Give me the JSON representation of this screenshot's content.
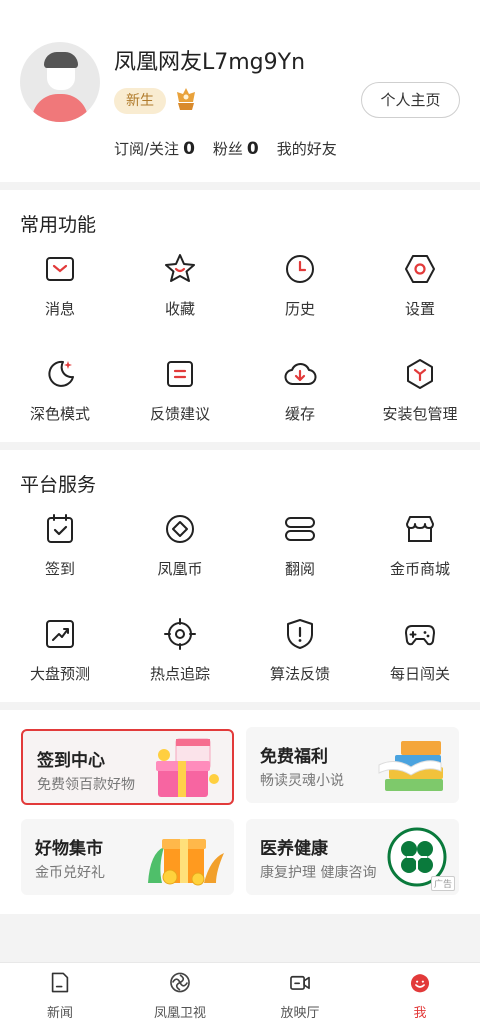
{
  "profile": {
    "username": "凤凰网友L7mg9Yn",
    "badge": "新生",
    "home_button": "个人主页",
    "stats": [
      {
        "label": "订阅/关注",
        "value": "0"
      },
      {
        "label": "粉丝",
        "value": "0"
      },
      {
        "label": "我的好友",
        "value": ""
      }
    ]
  },
  "common": {
    "title": "常用功能",
    "items": [
      {
        "label": "消息",
        "icon": "message-icon"
      },
      {
        "label": "收藏",
        "icon": "star-icon"
      },
      {
        "label": "历史",
        "icon": "clock-icon"
      },
      {
        "label": "设置",
        "icon": "settings-icon"
      },
      {
        "label": "深色模式",
        "icon": "moon-icon"
      },
      {
        "label": "反馈建议",
        "icon": "feedback-icon"
      },
      {
        "label": "缓存",
        "icon": "download-cloud-icon"
      },
      {
        "label": "安装包管理",
        "icon": "package-icon"
      }
    ]
  },
  "platform": {
    "title": "平台服务",
    "items": [
      {
        "label": "签到",
        "icon": "checkin-icon"
      },
      {
        "label": "凤凰币",
        "icon": "coin-icon"
      },
      {
        "label": "翻阅",
        "icon": "book-icon"
      },
      {
        "label": "金币商城",
        "icon": "shop-icon"
      },
      {
        "label": "大盘预测",
        "icon": "chart-icon"
      },
      {
        "label": "热点追踪",
        "icon": "target-icon"
      },
      {
        "label": "算法反馈",
        "icon": "shield-icon"
      },
      {
        "label": "每日闯关",
        "icon": "gamepad-icon"
      }
    ]
  },
  "cards": [
    {
      "title": "签到中心",
      "subtitle": "免费领百款好物"
    },
    {
      "title": "免费福利",
      "subtitle": "畅读灵魂小说"
    },
    {
      "title": "好物集市",
      "subtitle": "金币兑好礼"
    },
    {
      "title": "医养健康",
      "subtitle": "康复护理 健康咨询",
      "ad": "广告"
    }
  ],
  "tabs": [
    {
      "label": "新闻",
      "icon": "news-icon"
    },
    {
      "label": "凤凰卫视",
      "icon": "phoenix-icon"
    },
    {
      "label": "放映厅",
      "icon": "video-icon"
    },
    {
      "label": "我",
      "icon": "me-icon",
      "active": true
    }
  ],
  "colors": {
    "accent": "#e23a3a",
    "badge_bg": "#f9ecd1",
    "badge_text": "#b07a2a"
  }
}
